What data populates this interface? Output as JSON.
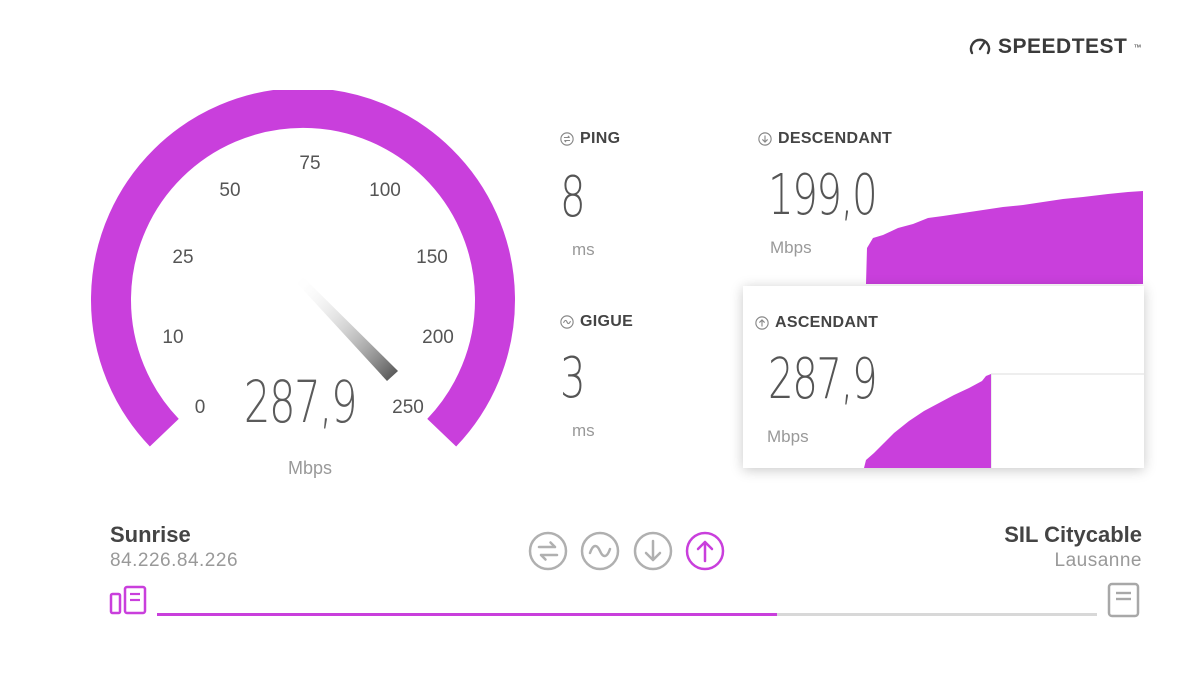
{
  "brand": {
    "name": "SPEEDTEST",
    "mark": "™",
    "icon": "gauge-icon"
  },
  "colors": {
    "accent": "#c93fdc",
    "text": "#555555",
    "muted": "#999999"
  },
  "gauge": {
    "ticks": [
      "0",
      "10",
      "25",
      "50",
      "75",
      "100",
      "150",
      "200",
      "250"
    ],
    "value": "287,9",
    "unit": "Mbps"
  },
  "ping": {
    "label": "PING",
    "value": "8",
    "unit": "ms",
    "icon": "ping-icon"
  },
  "jitter": {
    "label": "GIGUE",
    "value": "3",
    "unit": "ms",
    "icon": "jitter-icon"
  },
  "download": {
    "label": "DESCENDANT",
    "value": "199,0",
    "unit": "Mbps",
    "icon": "download-icon"
  },
  "upload": {
    "label": "ASCENDANT",
    "value": "287,9",
    "unit": "Mbps",
    "icon": "upload-icon"
  },
  "isp": {
    "name": "Sunrise",
    "ip": "84.226.84.226"
  },
  "server": {
    "name": "SIL Citycable",
    "location": "Lausanne"
  },
  "stages": [
    {
      "name": "ping",
      "icon": "ping-icon",
      "active": false
    },
    {
      "name": "jitter",
      "icon": "jitter-icon",
      "active": false
    },
    {
      "name": "download",
      "icon": "download-icon",
      "active": false
    },
    {
      "name": "upload",
      "icon": "upload-icon",
      "active": true
    }
  ],
  "progress": 0.66
}
